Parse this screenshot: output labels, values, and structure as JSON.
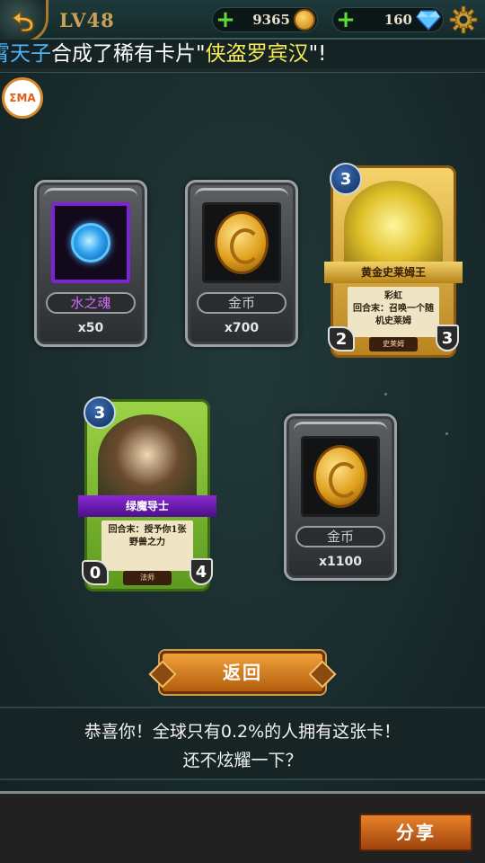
{
  "header": {
    "level": "LV48",
    "gold": "9365",
    "gems": "160"
  },
  "ticker": {
    "player": "霄天子",
    "middle": "合成了稀有卡片\"",
    "card": "侠盗罗宾汉",
    "end": "\"!"
  },
  "avatar_text": "ΣMA",
  "items": [
    {
      "name": "水之魂",
      "qty": "x50",
      "icon": "water-soul-icon"
    },
    {
      "name": "金币",
      "qty": "x700",
      "icon": "gold-coin-icon"
    },
    {
      "name": "金币",
      "qty": "x1100",
      "icon": "gold-coin-icon"
    }
  ],
  "cards": [
    {
      "name": "黄金史莱姆王",
      "cost": "3",
      "desc_line1": "彩虹",
      "desc_line2": "回合末：召唤一个随机史莱姆",
      "tribe": "史莱姆",
      "attack": "2",
      "health": "3"
    },
    {
      "name": "绿魔导士",
      "cost": "3",
      "desc_line1": "",
      "desc_line2": "回合末：授予你1张野兽之力",
      "tribe": "法师",
      "attack": "0",
      "health": "4"
    }
  ],
  "buttons": {
    "return": "返回",
    "share": "分享"
  },
  "congrats": {
    "line1": "恭喜你！全球只有0.2%的人拥有这张卡！",
    "line2": "还不炫耀一下？"
  },
  "colors": {
    "accent_gold": "#c9a155",
    "button_orange": "#e8822a",
    "rare_purple": "#7d22d6"
  }
}
